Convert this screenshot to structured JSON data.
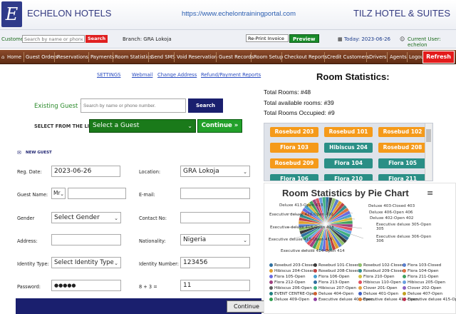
{
  "header": {
    "brand": "ECHELON HOTELS",
    "logo_letter": "E",
    "url": "https://www.echelontrainingportal.com",
    "hotel": "TILZ HOTEL & SUITES"
  },
  "customer_bar": {
    "customer_label": "Customer:",
    "search_placeholder": "Search by name or phone no",
    "search_btn": "Search",
    "branch_label": "Branch: GRA Lokoja",
    "reprint_value": "Re-Print Invoice",
    "preview_btn": "Preview",
    "today": "Today: 2023-06-26",
    "current_user": "Current User: echelon"
  },
  "nav": {
    "items": [
      "Home",
      "Guest Orders",
      "Reservations",
      "Payments",
      "Room Statistics",
      "Send SMS",
      "Void Reservation",
      "Guest Records",
      "Room Setup",
      "Checkout Reports",
      "Credit Customers",
      "Drivers",
      "Agents",
      "Logout"
    ],
    "refresh": "Refresh"
  },
  "links": [
    "SETTINGS",
    "Webmail",
    "Change Address",
    "Refund/Payment Reports"
  ],
  "form": {
    "existing_label": "Existing Guest ?",
    "existing_placeholder": "Search by name or phone number.",
    "search_btn": "Search",
    "select_list_label": "SELECT FROM THE LIST",
    "select_guest": "Select a Guest",
    "continue_btn": "Continue »",
    "new_guest": "NEW GUEST",
    "reg_date_label": "Reg. Date:",
    "reg_date": "2023-06-26",
    "location_label": "Location:",
    "location": "GRA Lokoja",
    "guest_name_label": "Guest Name:",
    "title": "Mr",
    "email_label": "E-mail:",
    "gender_label": "Gender",
    "gender": "Select Gender",
    "contact_label": "Contact No:",
    "address_label": "Address:",
    "nationality_label": "Nationality:",
    "nationality": "Nigeria",
    "id_type_label": "Identity Type:",
    "id_type": "Select Identity Type",
    "id_number_label": "Identity Number:",
    "id_number": "123456",
    "password_label": "Password:",
    "password": "●●●●●",
    "captcha_label": "8 + 3 =",
    "captcha_answer": "11",
    "continue_bottom": "Continue"
  },
  "stats": {
    "title": "Room Statistics:",
    "total_rooms": "Total Rooms: #48",
    "total_available": "Total available rooms: #39",
    "total_occupied": "Total Rooms Occupied: #9"
  },
  "rooms": [
    {
      "name": "Rosebud 203",
      "status": "orange"
    },
    {
      "name": "Rosebud 101",
      "status": "orange"
    },
    {
      "name": "Rosebud 102",
      "status": "orange"
    },
    {
      "name": "Flora 103",
      "status": "orange"
    },
    {
      "name": "Hibiscus 204",
      "status": "teal"
    },
    {
      "name": "Rosebud 208",
      "status": "orange"
    },
    {
      "name": "Rosebud 209",
      "status": "orange"
    },
    {
      "name": "Flora 104",
      "status": "teal"
    },
    {
      "name": "Flora 105",
      "status": "teal"
    },
    {
      "name": "Flora 106",
      "status": "teal"
    },
    {
      "name": "Flora 210",
      "status": "teal"
    },
    {
      "name": "Flora 211",
      "status": "teal"
    }
  ],
  "colors": {
    "orange": "#f59a1a",
    "teal": "#2a8f86",
    "nav_brown": "#6e3519",
    "navy": "#1a1f6e",
    "green": "#1a8a2a",
    "red": "#e02020"
  },
  "chart_data": {
    "type": "pie",
    "title": "Room Statistics by Pie Chart",
    "pie_labels": [
      "Deluxe 413-Open 413",
      "Executive deluxe 420-Open 420",
      "Executive deluxe 418-Open 418",
      "Executive deluxe 415-Open 415",
      "Executive deluxe 414-Open 414",
      "Deluxe 403-Closed 403",
      "Deluxe 406-Open 406",
      "Deluxe 402-Open 402",
      "Executive deluxe 305-Open 305",
      "Executive deluxe 306-Open 306"
    ],
    "legend": [
      {
        "name": "Rosebud 203-Closed",
        "color": "#2f6f9f"
      },
      {
        "name": "Rosebud 101-Closed",
        "color": "#3a3a3a"
      },
      {
        "name": "Rosebud 102-Closed",
        "color": "#8fbf6a"
      },
      {
        "name": "Flora 103-Closed",
        "color": "#5b7fcf"
      },
      {
        "name": "Hibiscus 204-Closed",
        "color": "#e0a030"
      },
      {
        "name": "Rosebud 208-Closed",
        "color": "#c04040"
      },
      {
        "name": "Rosebud 209-Closed",
        "color": "#2f8f8f"
      },
      {
        "name": "Flora 104-Open",
        "color": "#e07040"
      },
      {
        "name": "Flora 105-Open",
        "color": "#6a6adf"
      },
      {
        "name": "Flora 106-Open",
        "color": "#4aa0d0"
      },
      {
        "name": "Flora 210-Open",
        "color": "#d0c040"
      },
      {
        "name": "Flora 211-Open",
        "color": "#40a060"
      },
      {
        "name": "Flora 212-Open",
        "color": "#a04080"
      },
      {
        "name": "Flora 213-Open",
        "color": "#2f6f9f"
      },
      {
        "name": "Hibiscus 110-Open",
        "color": "#e05060"
      },
      {
        "name": "Hibiscus 205-Open",
        "color": "#6aa0e0"
      },
      {
        "name": "Hibiscus 206-Open",
        "color": "#606060"
      },
      {
        "name": "Hibiscus 207-Open",
        "color": "#40b080"
      },
      {
        "name": "Clover 201-Open",
        "color": "#e0a040"
      },
      {
        "name": "Clover 202-Open",
        "color": "#8a60c0"
      },
      {
        "name": "EVENT CENTRE-Open",
        "color": "#208080"
      },
      {
        "name": "Deluxe 404-Open",
        "color": "#d06030"
      },
      {
        "name": "Deluxe 401-Open",
        "color": "#4060c0"
      },
      {
        "name": "Deluxe 407-Open",
        "color": "#c0a020"
      },
      {
        "name": "Deluxe 409-Open",
        "color": "#30a050"
      },
      {
        "name": "Executive deluxe 408-Open",
        "color": "#9040a0"
      },
      {
        "name": "Executive deluxe 414-Open",
        "color": "#e08030"
      },
      {
        "name": "Executive deluxe 415-Open",
        "color": "#c03050"
      }
    ],
    "slice_count": 48,
    "slice_colors": [
      "#2f6f9f",
      "#3a3a3a",
      "#8fbf6a",
      "#5b7fcf",
      "#e0a030",
      "#c04040",
      "#2f8f8f",
      "#e07040",
      "#6a6adf",
      "#4aa0d0",
      "#d0c040",
      "#40a060",
      "#a04080",
      "#e05060",
      "#6aa0e0",
      "#40b080"
    ]
  }
}
